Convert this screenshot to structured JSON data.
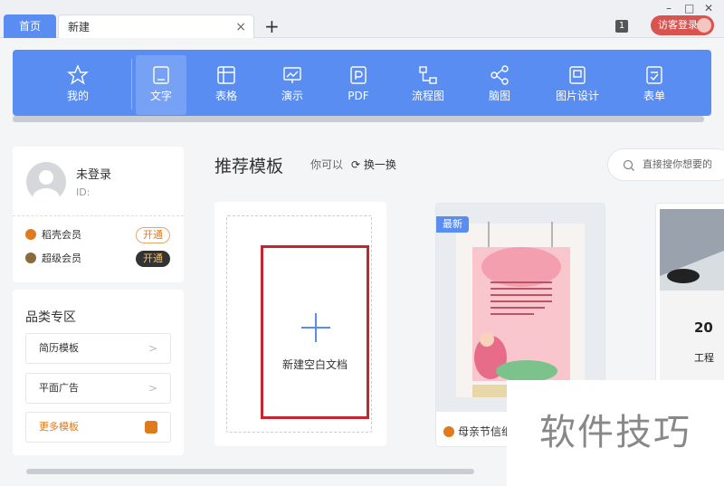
{
  "tabs": {
    "home": "首页",
    "new": "新建",
    "close_icon": "×",
    "add_icon": "+"
  },
  "window": {
    "badge": "1",
    "guest_login": "访客登录",
    "minimize": "–",
    "maximize": "□",
    "close": "✕"
  },
  "toolbar": {
    "items": [
      {
        "label": "我的",
        "icon": "star-icon"
      },
      {
        "label": "文字",
        "icon": "document-icon",
        "active": true
      },
      {
        "label": "表格",
        "icon": "spreadsheet-icon"
      },
      {
        "label": "演示",
        "icon": "presentation-icon"
      },
      {
        "label": "PDF",
        "icon": "pdf-icon"
      },
      {
        "label": "流程图",
        "icon": "flowchart-icon"
      },
      {
        "label": "脑图",
        "icon": "mindmap-icon"
      },
      {
        "label": "图片设计",
        "icon": "image-design-icon"
      },
      {
        "label": "表单",
        "icon": "form-icon"
      }
    ]
  },
  "user": {
    "name": "未登录",
    "id": "ID:",
    "members": [
      {
        "label": "稻壳会员",
        "button": "开通",
        "color": "#e07a1f"
      },
      {
        "label": "超级会员",
        "button": "开通",
        "color": "#8a6a3a"
      }
    ]
  },
  "categories": {
    "title": "品类专区",
    "items": [
      "简历模板",
      "平面广告",
      "更多模板"
    ],
    "chevron": ">"
  },
  "main": {
    "title": "推荐模板",
    "subtitle": "你可以",
    "refresh": "换一换",
    "search_placeholder": "直接搜你想要的",
    "blank_doc": "新建空白文档"
  },
  "template": {
    "badge": "最新",
    "name": "母亲节信纸",
    "year": "20",
    "sub": "工程"
  },
  "watermark": "软件技巧",
  "colors": {
    "accent": "#5a8df2",
    "highlight_box": "#c7252d",
    "orange": "#e07a1f"
  }
}
